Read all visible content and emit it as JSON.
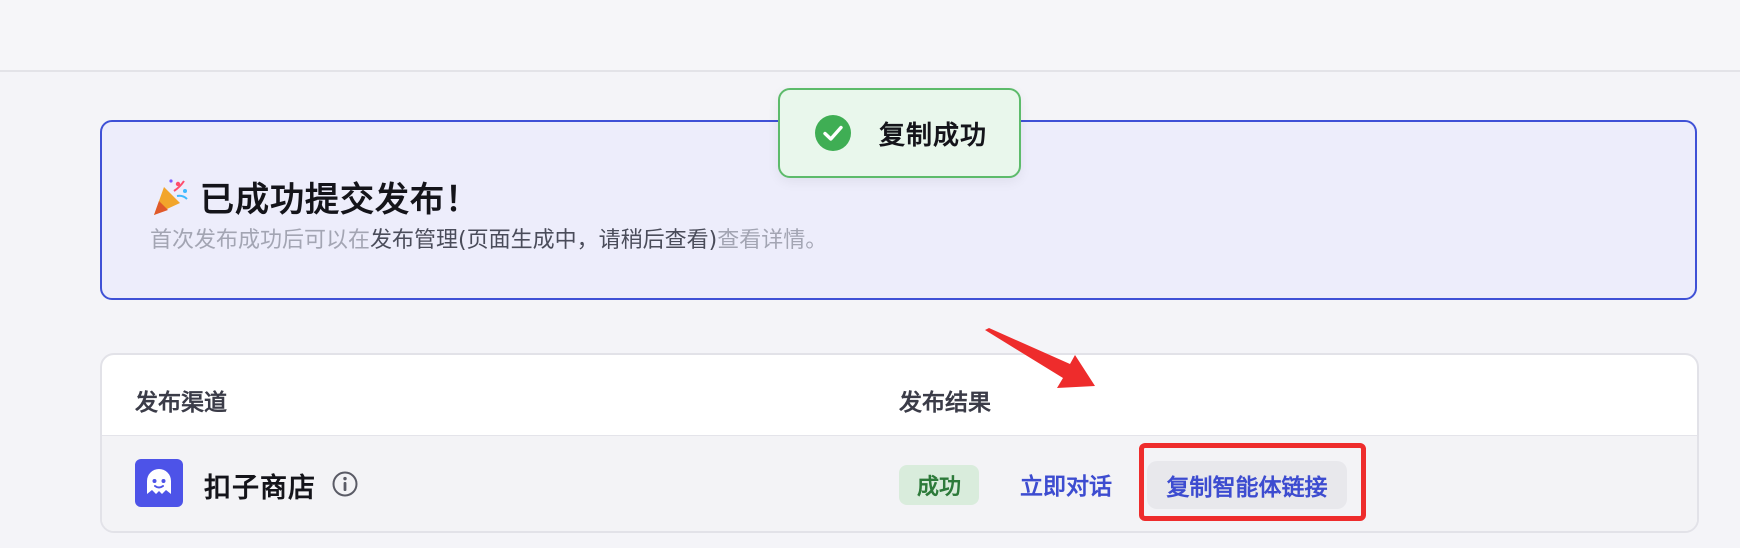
{
  "banner": {
    "title": "已成功提交发布！",
    "desc_prefix": "首次发布成功后可以在",
    "desc_link": "发布管理(页面生成中，请稍后查看)",
    "desc_suffix": "查看详情。"
  },
  "toast": {
    "message": "复制成功",
    "icon": "check-circle-icon",
    "color": "#5dbb6b"
  },
  "table": {
    "headers": {
      "channel": "发布渠道",
      "result": "发布结果"
    },
    "rows": [
      {
        "channel_name": "扣子商店",
        "status": "成功",
        "chat_action": "立即对话",
        "copy_action": "复制智能体链接"
      }
    ]
  },
  "annotation": {
    "highlight_color": "#ee2c2c"
  }
}
